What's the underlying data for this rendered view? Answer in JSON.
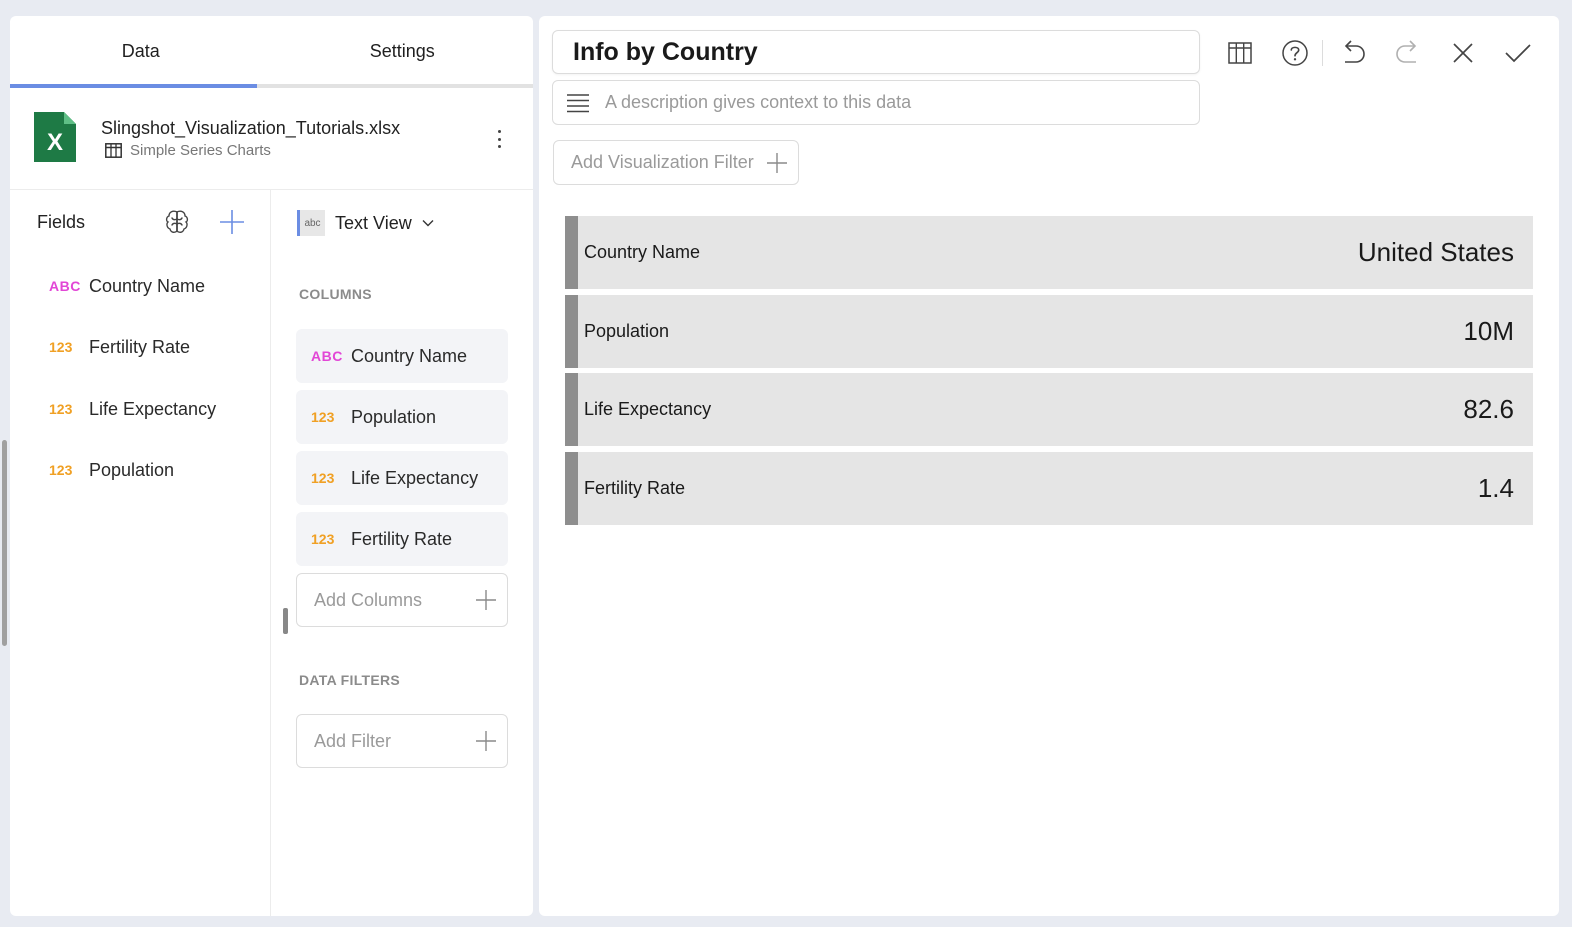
{
  "tabs": {
    "data": "Data",
    "settings": "Settings"
  },
  "source": {
    "file": "Slingshot_Visualization_Tutorials.xlsx",
    "sheet": "Simple Series Charts",
    "excel_letter": "X"
  },
  "fields": {
    "title": "Fields",
    "items": [
      {
        "type": "ABC",
        "label": "Country Name"
      },
      {
        "type": "123",
        "label": "Fertility Rate"
      },
      {
        "type": "123",
        "label": "Life Expectancy"
      },
      {
        "type": "123",
        "label": "Population"
      }
    ]
  },
  "config": {
    "viz_type": "Text View",
    "viz_tile": "abc",
    "columns_label": "COLUMNS",
    "columns": [
      {
        "type": "ABC",
        "label": "Country Name"
      },
      {
        "type": "123",
        "label": "Population"
      },
      {
        "type": "123",
        "label": "Life Expectancy"
      },
      {
        "type": "123",
        "label": "Fertility Rate"
      }
    ],
    "add_columns": "Add Columns",
    "data_filters_label": "DATA FILTERS",
    "add_filter": "Add Filter"
  },
  "editor": {
    "title": "Info by Country",
    "description_placeholder": "A description gives context to this data",
    "add_viz_filter": "Add Visualization Filter"
  },
  "kpis": [
    {
      "label": "Country Name",
      "value": "United States"
    },
    {
      "label": "Population",
      "value": "10M"
    },
    {
      "label": "Life Expectancy",
      "value": "82.6"
    },
    {
      "label": "Fertility Rate",
      "value": "1.4"
    }
  ],
  "colors": {
    "accent": "#6b8de3",
    "excel_green": "#1e7a45",
    "string_type": "#e246d6",
    "number_type": "#f0a024",
    "kpi_bar": "#8e8e8e"
  }
}
